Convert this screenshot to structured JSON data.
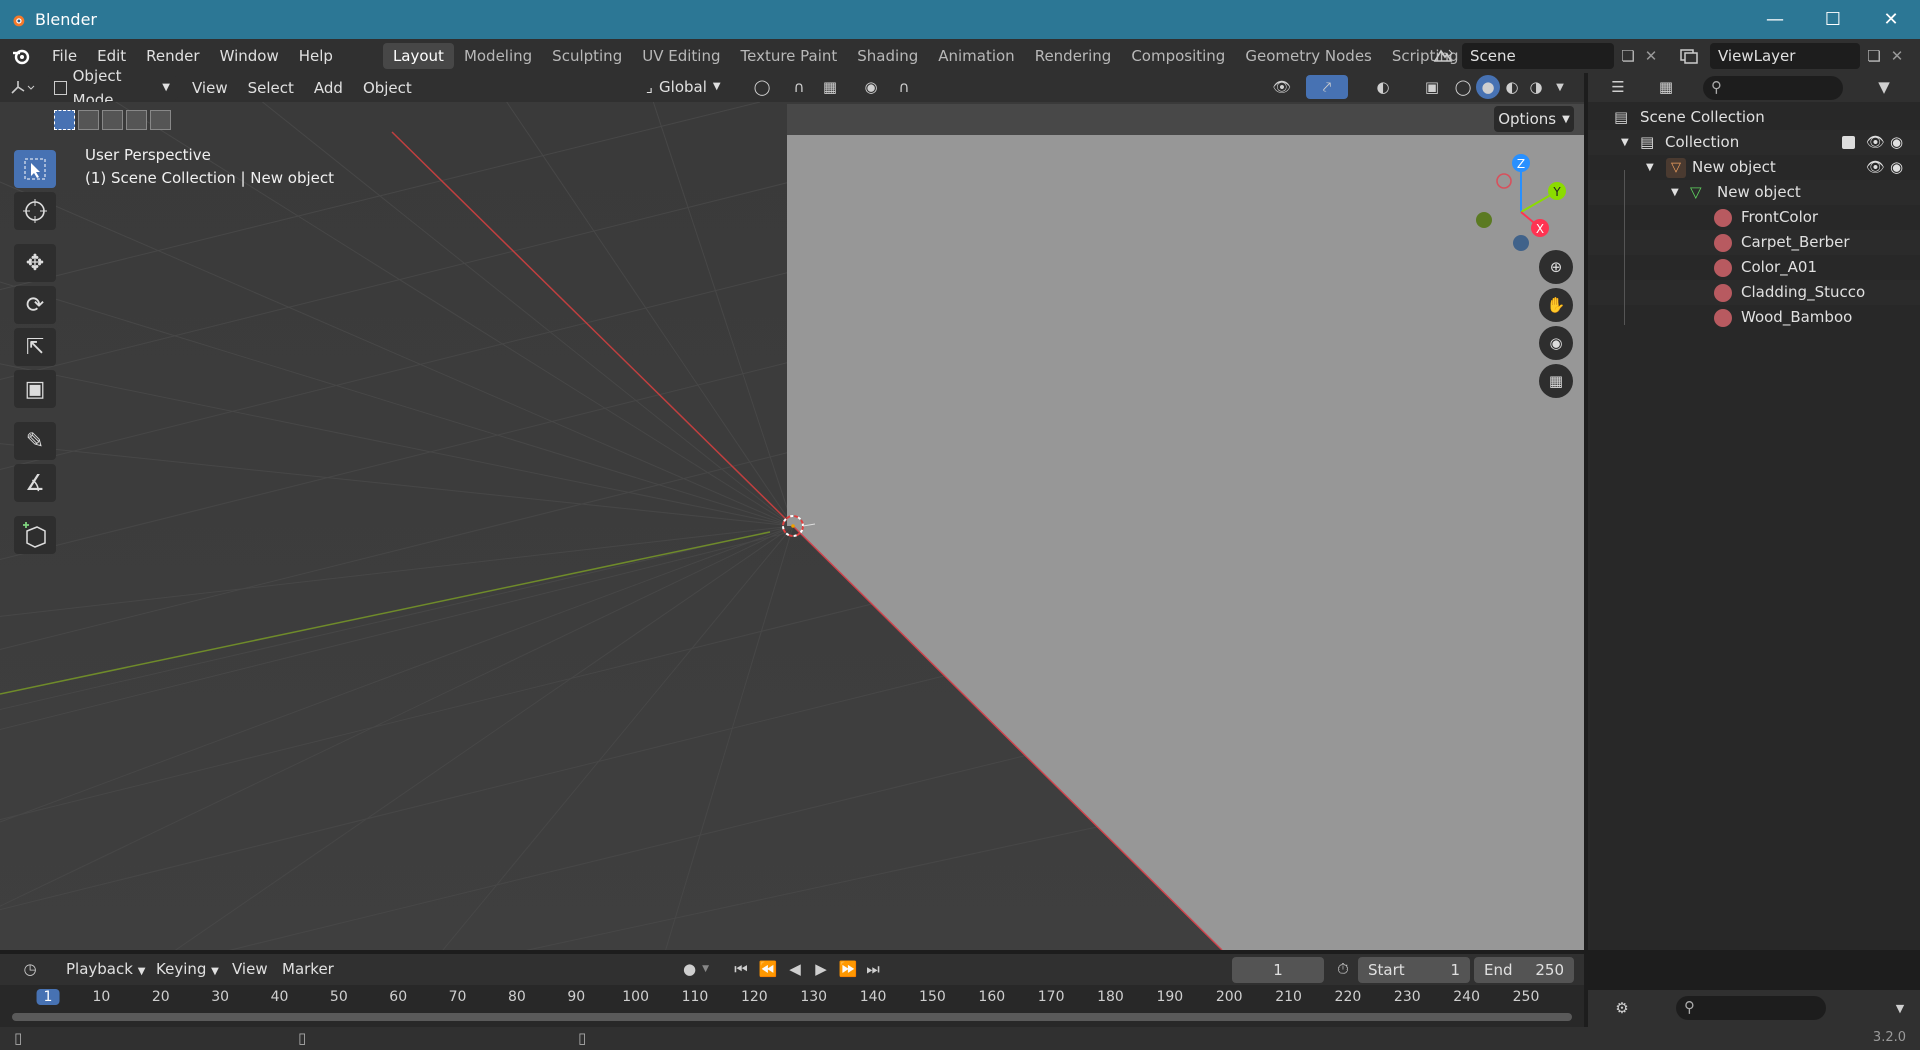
{
  "window": {
    "title": "Blender"
  },
  "menu": [
    "File",
    "Edit",
    "Render",
    "Window",
    "Help"
  ],
  "workspaces": [
    {
      "label": "Layout",
      "active": true
    },
    {
      "label": "Modeling"
    },
    {
      "label": "Sculpting"
    },
    {
      "label": "UV Editing"
    },
    {
      "label": "Texture Paint"
    },
    {
      "label": "Shading"
    },
    {
      "label": "Animation"
    },
    {
      "label": "Rendering"
    },
    {
      "label": "Compositing"
    },
    {
      "label": "Geometry Nodes"
    },
    {
      "label": "Scripting"
    }
  ],
  "scene": {
    "name": "Scene"
  },
  "view_layer": {
    "name": "ViewLayer"
  },
  "viewport_header": {
    "mode": "Object Mode",
    "menus": [
      "View",
      "Select",
      "Add",
      "Object"
    ],
    "orientation": "Global",
    "options_label": "Options"
  },
  "viewport": {
    "perspective": "User Perspective",
    "context": "(1) Scene Collection | New object",
    "gizmo": {
      "z": "Z",
      "y": "Y",
      "x": "X"
    }
  },
  "outliner": {
    "root": "Scene Collection",
    "collection": "Collection",
    "object": "New object",
    "mesh": "New object",
    "materials": [
      "FrontColor",
      "Carpet_Berber",
      "Color_A01",
      "Cladding_Stucco",
      "Wood_Bamboo"
    ]
  },
  "timeline": {
    "menus": [
      "Playback",
      "Keying",
      "View",
      "Marker"
    ],
    "current_frame": "1",
    "start_label": "Start",
    "start": "1",
    "end_label": "End",
    "end": "250",
    "ruler": [
      "1",
      "10",
      "20",
      "30",
      "40",
      "50",
      "60",
      "70",
      "80",
      "90",
      "100",
      "110",
      "120",
      "130",
      "140",
      "150",
      "160",
      "170",
      "180",
      "190",
      "200",
      "210",
      "220",
      "230",
      "240",
      "250"
    ]
  },
  "status": {
    "version": "3.2.0"
  },
  "colors": {
    "titlebar": "#2c7795",
    "active_tool": "#4772b3",
    "x_axis": "#ff3352",
    "y_axis": "#8bdc00",
    "z_axis": "#2890ff"
  }
}
